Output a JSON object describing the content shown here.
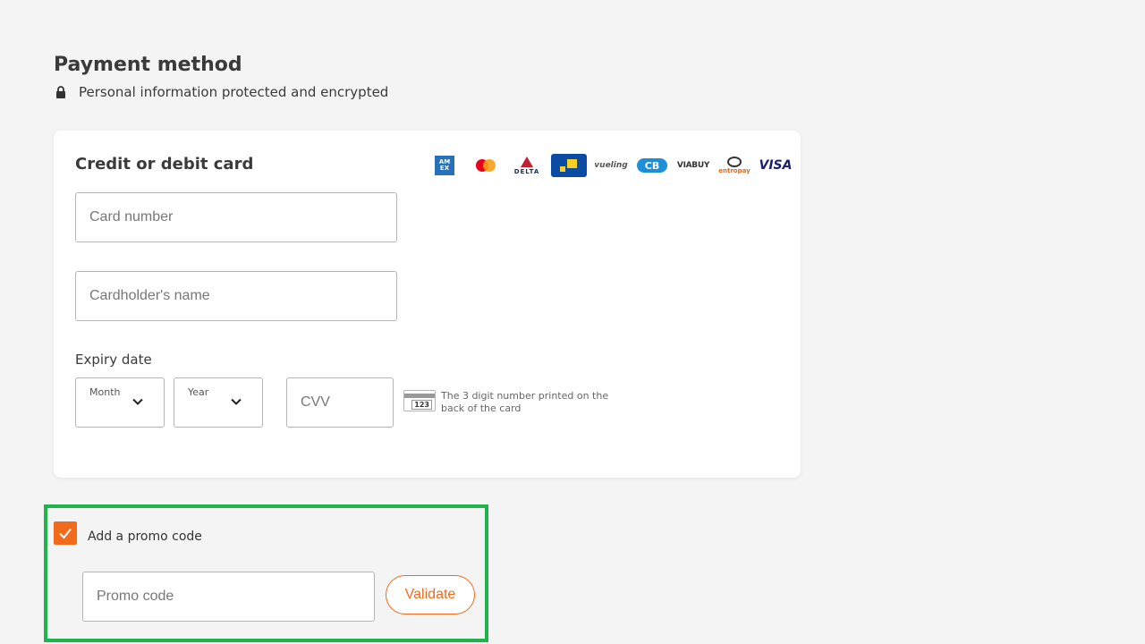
{
  "page": {
    "title": "Payment method",
    "secure_note": "Personal information protected and encrypted"
  },
  "card_panel": {
    "title": "Credit or debit card",
    "logos": [
      "American Express",
      "Mastercard",
      "Delta",
      "blue card",
      "vueling",
      "CB",
      "VIABUY",
      "entropay",
      "VISA"
    ],
    "logo_text": {
      "amex": "AM EX",
      "delta": "DELTA",
      "vueling": "vueling",
      "cb": "CB",
      "viabuy": "VIABUY",
      "entropay": "entropay",
      "visa": "VISA"
    },
    "card_number_placeholder": "Card number",
    "cardholder_placeholder": "Cardholder's name",
    "expiry_label": "Expiry date",
    "month_label": "Month",
    "year_label": "Year",
    "cvv_placeholder": "CVV",
    "cvv_card_digits": "123",
    "cvv_hint": "The 3 digit number printed on the back of the card"
  },
  "promo": {
    "checkbox_checked": true,
    "label": "Add a promo code",
    "input_placeholder": "Promo code",
    "validate_label": "Validate"
  },
  "colors": {
    "accent": "#f26a1b",
    "highlight_border": "#1fb44b",
    "background": "#f4f4f4"
  }
}
